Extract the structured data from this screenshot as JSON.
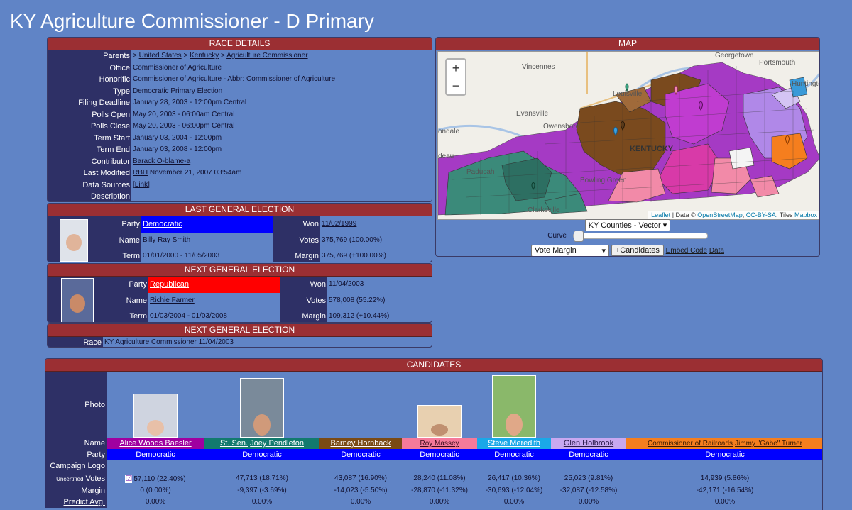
{
  "page": {
    "title": "KY Agriculture Commissioner - D Primary"
  },
  "race_details": {
    "header": "RACE DETAILS",
    "rows": [
      {
        "key": "Parents",
        "parts": [
          ">",
          "United States",
          ">",
          "Kentucky",
          ">",
          "Agriculture Commissioner"
        ]
      },
      {
        "key": "Office",
        "value": "Commissioner of Agriculture"
      },
      {
        "key": "Honorific",
        "value": "Commissioner of Agriculture - Abbr: Commissioner of Agriculture"
      },
      {
        "key": "Type",
        "value": "Democratic Primary Election"
      },
      {
        "key": "Filing Deadline",
        "value": "January 28, 2003 - 12:00pm Central"
      },
      {
        "key": "Polls Open",
        "value": "May 20, 2003 - 06:00am Central"
      },
      {
        "key": "Polls Close",
        "value": "May 20, 2003 - 06:00pm Central"
      },
      {
        "key": "Term Start",
        "value": "January 03, 2004 - 12:00pm"
      },
      {
        "key": "Term End",
        "value": "January 03, 2008 - 12:00pm"
      },
      {
        "key": "Contributor",
        "link": "Barack O-blame-a"
      },
      {
        "key": "Last Modified",
        "link": "RBH",
        "value": "November 21, 2007 03:54am"
      },
      {
        "key": "Data Sources",
        "link": "[Link]"
      },
      {
        "key": "Description",
        "value": ""
      }
    ]
  },
  "last_general": {
    "header": "LAST GENERAL ELECTION",
    "party_label": "Party",
    "party": "Democratic",
    "name_label": "Name",
    "name": "Billy Ray Smith",
    "term_label": "Term",
    "term": "01/01/2000 - 11/05/2003",
    "won_label": "Won",
    "won": "11/02/1999",
    "votes_label": "Votes",
    "votes": "375,769 (100.00%)",
    "margin_label": "Margin",
    "margin": "375,769 (+100.00%)"
  },
  "next_general": {
    "header": "NEXT GENERAL ELECTION",
    "party_label": "Party",
    "party": "Republican",
    "name_label": "Name",
    "name": "Richie Farmer",
    "term_label": "Term",
    "term": "01/03/2004 - 01/03/2008",
    "won_label": "Won",
    "won": "11/04/2003",
    "votes_label": "Votes",
    "votes": "578,008 (55.22%)",
    "margin_label": "Margin",
    "margin": "109,312 (+10.44%)"
  },
  "next_race": {
    "header": "NEXT GENERAL ELECTION",
    "race_label": "Race",
    "race": "KY Agriculture Commissioner 11/04/2003"
  },
  "map": {
    "header": "MAP",
    "zoom_in": "+",
    "zoom_out": "−",
    "attribution": {
      "leaflet": "Leaflet",
      "data": "| Data ©",
      "osm": "OpenStreetMap",
      "license": "CC-BY-SA",
      "tiles": ", Tiles",
      "mapbox": "Mapbox"
    },
    "places": [
      "Georgetown",
      "Vincennes",
      "Portsmouth",
      "Huntington",
      "Louisville",
      "Evansville",
      "KENTUCKY",
      "Owensboro",
      "Bowling Green",
      "Paducah",
      "Clarksville",
      "ondale",
      "deau"
    ],
    "layer_select": "KY Counties - Vector",
    "curve_label": "Curve",
    "mode_select": "Vote Margin",
    "candidates_button": "+Candidates",
    "embed_link": "Embed Code",
    "data_link": "Data"
  },
  "candidates": {
    "header": "CANDIDATES",
    "row_labels": {
      "photo": "Photo",
      "name": "Name",
      "party": "Party",
      "logo": "Campaign Logo",
      "votes_prefix": "Uncertified",
      "votes": "Votes",
      "margin": "Margin",
      "predict": "Predict Avg."
    },
    "list": [
      {
        "name": "Alice Woods Baesler",
        "prefix": "",
        "color": "#a000a0",
        "text_color": "#ffffff",
        "party": "Democratic",
        "votes": "57,110 (22.40%)",
        "margin": "0 (0.00%)",
        "predict": "0.00%",
        "winner": true
      },
      {
        "name": "Joey Pendleton",
        "prefix": "St. Sen.",
        "color": "#127a6e",
        "text_color": "#ffffff",
        "party": "Democratic",
        "votes": "47,713 (18.71%)",
        "margin": "-9,397 (-3.69%)",
        "predict": "0.00%",
        "winner": false
      },
      {
        "name": "Barney Hornback",
        "prefix": "",
        "color": "#7a4a14",
        "text_color": "#ffffff",
        "party": "Democratic",
        "votes": "43,087 (16.90%)",
        "margin": "-14,023 (-5.50%)",
        "predict": "0.00%",
        "winner": false
      },
      {
        "name": "Roy Massey",
        "prefix": "",
        "color": "#f57a9a",
        "text_color": "#3a0a1a",
        "party": "Democratic",
        "votes": "28,240 (11.08%)",
        "margin": "-28,870 (-11.32%)",
        "predict": "0.00%",
        "winner": false
      },
      {
        "name": "Steve Meredith",
        "prefix": "",
        "color": "#1aa8e8",
        "text_color": "#ffffff",
        "party": "Democratic",
        "votes": "26,417 (10.36%)",
        "margin": "-30,693 (-12.04%)",
        "predict": "0.00%",
        "winner": false
      },
      {
        "name": "Glen Holbrook",
        "prefix": "",
        "color": "#c8a8f0",
        "text_color": "#2a1a4a",
        "party": "Democratic",
        "votes": "25,023 (9.81%)",
        "margin": "-32,087 (-12.58%)",
        "predict": "0.00%",
        "winner": false
      },
      {
        "name": "Jimmy \"Gabe\" Turner",
        "prefix": "Commissioner of Railroads",
        "color": "#f57e1e",
        "text_color": "#3a1a00",
        "party": "Democratic",
        "votes": "14,939 (5.86%)",
        "margin": "-42,171 (-16.54%)",
        "predict": "0.00%",
        "winner": false
      }
    ]
  }
}
